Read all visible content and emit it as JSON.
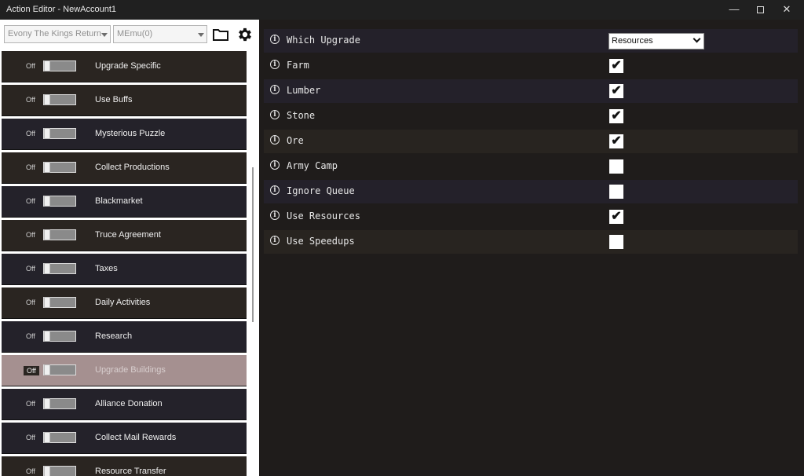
{
  "window": {
    "title": "Action Editor - NewAccount1",
    "minimize_glyph": "—",
    "close_glyph": "✕"
  },
  "toolbar": {
    "game_combo": "Evony The Kings Return",
    "emulator_combo": "MEmu(0)",
    "folder_icon": "folder-icon",
    "settings_icon": "gear-icon"
  },
  "actions": [
    {
      "state": "Off",
      "label": "Upgrade Specific"
    },
    {
      "state": "Off",
      "label": "Use Buffs"
    },
    {
      "state": "Off",
      "label": "Mysterious Puzzle"
    },
    {
      "state": "Off",
      "label": "Collect Productions"
    },
    {
      "state": "Off",
      "label": "Blackmarket"
    },
    {
      "state": "Off",
      "label": "Truce Agreement"
    },
    {
      "state": "Off",
      "label": "Taxes"
    },
    {
      "state": "Off",
      "label": "Daily Activities"
    },
    {
      "state": "Off",
      "label": "Research"
    },
    {
      "state": "Off",
      "label": "Upgrade Buildings"
    },
    {
      "state": "Off",
      "label": "Alliance Donation"
    },
    {
      "state": "Off",
      "label": "Collect Mail Rewards"
    },
    {
      "state": "Off",
      "label": "Resource Transfer"
    }
  ],
  "selected_action": "Upgrade Buildings",
  "settings": {
    "info_glyph": "i",
    "which_upgrade": {
      "label": "Which Upgrade",
      "value": "Resources"
    },
    "options": [
      {
        "label": "Farm",
        "checked": true,
        "mark": "✔"
      },
      {
        "label": "Lumber",
        "checked": true,
        "mark": "✔"
      },
      {
        "label": "Stone",
        "checked": true,
        "mark": "✔"
      },
      {
        "label": "Ore",
        "checked": true,
        "mark": "✔"
      },
      {
        "label": "Army Camp",
        "checked": false,
        "mark": ""
      },
      {
        "label": "Ignore Queue",
        "checked": false,
        "mark": ""
      },
      {
        "label": "Use Resources",
        "checked": true,
        "mark": "✔"
      },
      {
        "label": "Use Speedups",
        "checked": false,
        "mark": ""
      }
    ]
  },
  "colors": {
    "panel_bg": "#1f1c1b",
    "selected_item": "#a59090"
  }
}
